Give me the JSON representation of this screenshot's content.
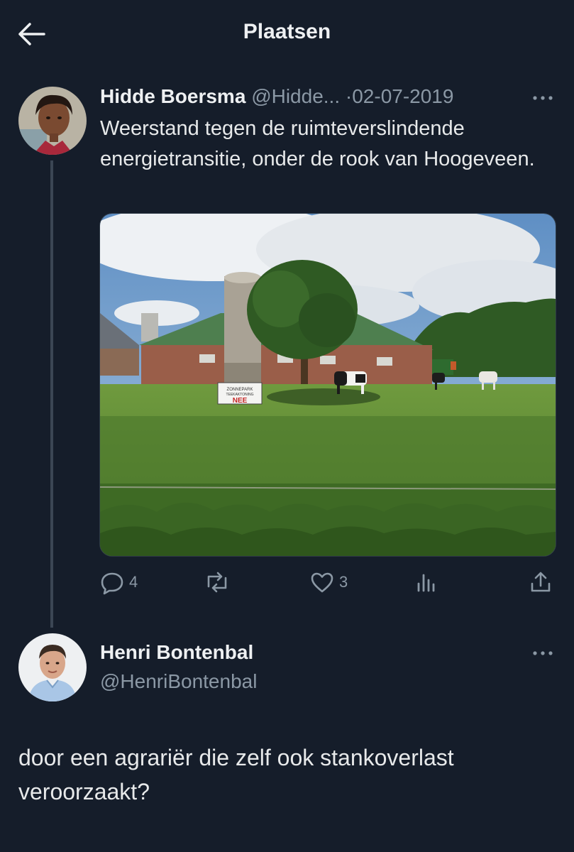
{
  "header": {
    "title": "Plaatsen"
  },
  "tweet": {
    "author_name": "Hidde Boersma",
    "author_handle": "@Hidde...",
    "separator": "·",
    "date": "02-07-2019",
    "text": "Weerstand tegen de ruimteverslindende energietransitie, onder de rook van Hoogeveen.",
    "image_sign_small": "ZONNEPARK\nTEEKAKTONING",
    "image_sign_big": "NEE",
    "actions": {
      "replies": "4",
      "reposts": "",
      "likes": "3"
    }
  },
  "reply": {
    "author_name": "Henri Bontenbal",
    "author_handle": "@HenriBontenbal",
    "text": "door een agrariër die zelf ook stankoverlast veroorzaakt?"
  },
  "icons": [
    "back-arrow-icon",
    "more-icon",
    "reply-icon",
    "repost-icon",
    "like-icon",
    "views-icon",
    "share-icon"
  ],
  "colors": {
    "background": "#151d2a",
    "text": "#e7e9ea",
    "muted": "#8b98a5",
    "thread_line": "#3b4654"
  }
}
